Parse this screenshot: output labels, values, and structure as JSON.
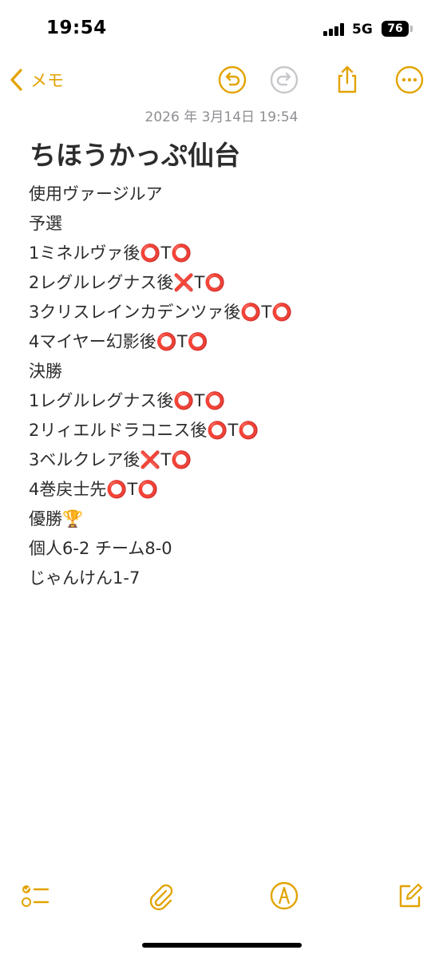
{
  "status": {
    "time": "19:54",
    "network": "5G",
    "battery": "76"
  },
  "nav": {
    "back_label": "メモ"
  },
  "note": {
    "date": "2026 年 3月14日 19:54",
    "title": "ちほうかっぷ仙台",
    "lines": [
      "使用ヴァージルア",
      "予選",
      "1ミネルヴァ後⭕T⭕",
      "2レグルレグナス後❌T⭕",
      "3クリスレインカデンツァ後⭕T⭕",
      "4マイヤー幻影後⭕T⭕",
      "決勝",
      "1レグルレグナス後⭕T⭕",
      "2リィエルドラコニス後⭕T⭕",
      "3ベルクレア後❌T⭕",
      "4巻戻士先⭕T⭕",
      "優勝🏆",
      "個人6-2 チーム8-0",
      "じゃんけん1-7"
    ]
  },
  "icons": {
    "back": "chevron-left-icon",
    "undo": "undo-icon",
    "redo": "redo-icon",
    "share": "share-icon",
    "more": "more-icon",
    "checklist": "checklist-icon",
    "attach": "paperclip-icon",
    "markup": "markup-pen-icon",
    "compose": "compose-icon"
  },
  "colors": {
    "accent": "#e2a300",
    "disabled": "#c7c7cc",
    "date_text": "#8e8e93",
    "body_text": "#2c2c2e"
  }
}
